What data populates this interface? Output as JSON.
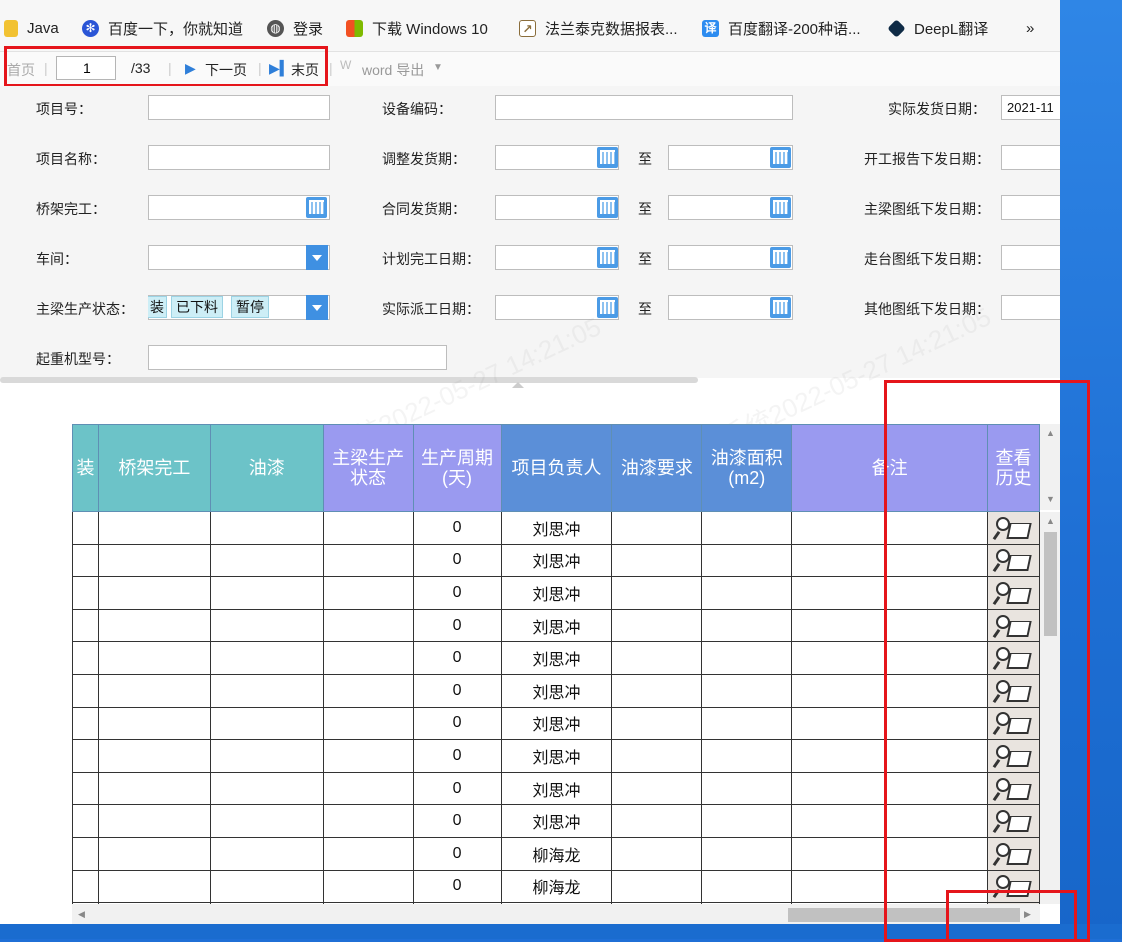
{
  "bookmarks": [
    {
      "label": "Java",
      "icon": "folder-icon",
      "color": "#f2c232"
    },
    {
      "label": "百度一下，你就知道",
      "icon": "baidu-paw-icon",
      "color": "#2a55d6"
    },
    {
      "label": "登录",
      "icon": "globe-icon",
      "color": "#555555"
    },
    {
      "label": "下载 Windows 10",
      "icon": "windows-logo-icon",
      "color": "#f25022"
    },
    {
      "label": "法兰泰克数据报表...",
      "icon": "chart-image-icon",
      "color": "#8a6d3b"
    },
    {
      "label": "百度翻译-200种语...",
      "icon": "translate-icon",
      "color": "#2d8cf0"
    },
    {
      "label": "DeepL翻译",
      "icon": "deepl-icon",
      "color": "#0f2b46"
    }
  ],
  "more_glyph": "»",
  "toolbar": {
    "first_page": "首页",
    "current_page": "1",
    "total_pages": "/33",
    "next_page": "下一页",
    "last_page": "末页",
    "export": "word 导出"
  },
  "filters": {
    "project_no": "项目号：",
    "project_name": "项目名称：",
    "bridge_done": "桥架完工：",
    "workshop": "车间：",
    "girder_status": "主梁生产状态：",
    "crane_model": "起重机型号：",
    "equipment_code": "设备编码：",
    "adjusted_ship": "调整发货期：",
    "contract_ship": "合同发货期：",
    "planned_done": "计划完工日期：",
    "actual_dispatch": "实际派工日期：",
    "to": "至",
    "actual_ship": "实际发货日期：",
    "actual_ship_value": "2021-11",
    "start_report": "开工报告下发日期：",
    "girder_drawing": "主梁图纸下发日期：",
    "platform_drawing": "走台图纸下发日期：",
    "other_drawing": "其他图纸下发日期：",
    "status_tags": [
      "装",
      "已下料",
      "暂停"
    ]
  },
  "table": {
    "headers": [
      {
        "label": "装",
        "color": "#6cc3c8"
      },
      {
        "label": "桥架完工",
        "color": "#6cc3c8"
      },
      {
        "label": "油漆",
        "color": "#6cc3c8"
      },
      {
        "label": "主梁生产状态",
        "color": "#9a9af0"
      },
      {
        "label": "生产周期(天)",
        "color": "#9a9af0"
      },
      {
        "label": "项目负责人",
        "color": "#5b8fd8"
      },
      {
        "label": "油漆要求",
        "color": "#5b8fd8"
      },
      {
        "label": "油漆面积(m2)",
        "color": "#5b8fd8"
      },
      {
        "label": "备注",
        "color": "#9a9af0"
      },
      {
        "label": "查看历史",
        "color": "#9a9af0"
      }
    ],
    "rows": [
      {
        "cycle": "0",
        "owner": "刘思冲"
      },
      {
        "cycle": "0",
        "owner": "刘思冲"
      },
      {
        "cycle": "0",
        "owner": "刘思冲"
      },
      {
        "cycle": "0",
        "owner": "刘思冲"
      },
      {
        "cycle": "0",
        "owner": "刘思冲"
      },
      {
        "cycle": "0",
        "owner": "刘思冲"
      },
      {
        "cycle": "0",
        "owner": "刘思冲"
      },
      {
        "cycle": "0",
        "owner": "刘思冲"
      },
      {
        "cycle": "0",
        "owner": "刘思冲"
      },
      {
        "cycle": "0",
        "owner": "刘思冲"
      },
      {
        "cycle": "0",
        "owner": "柳海龙"
      },
      {
        "cycle": "0",
        "owner": "柳海龙"
      },
      {
        "cycle": "",
        "owner": ""
      }
    ]
  },
  "watermarks": [
    "法兰泰克报表系统2022-05-27 14:21:05"
  ]
}
